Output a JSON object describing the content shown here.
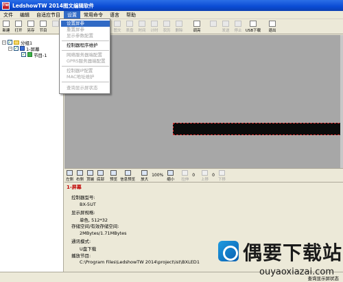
{
  "window": {
    "title": "LedshowTW 2014图文编辑软件",
    "icon_text": "TW"
  },
  "menu": [
    "文件",
    "编辑",
    "自适应节目",
    "设置",
    "常用命令",
    "语言",
    "帮助"
  ],
  "toolbar": {
    "buttons": [
      {
        "label": "新建",
        "disabled": false
      },
      {
        "label": "打开",
        "disabled": false
      },
      {
        "label": "另存",
        "disabled": false
      },
      {
        "label": "节目",
        "disabled": false
      },
      {
        "label": "",
        "disabled": true
      },
      {
        "label": "",
        "disabled": true
      },
      {
        "label": "文",
        "disabled": true
      },
      {
        "label": "字幕",
        "disabled": true
      },
      {
        "label": "动画",
        "disabled": true
      },
      {
        "label": "图文",
        "disabled": true
      },
      {
        "label": "表盘",
        "disabled": true
      },
      {
        "label": "时间",
        "disabled": true
      },
      {
        "label": "计时",
        "disabled": true
      },
      {
        "label": "农历",
        "disabled": true
      },
      {
        "label": "删除",
        "disabled": true
      },
      {
        "label": "调亮",
        "disabled": false
      },
      {
        "label": "",
        "disabled": true
      },
      {
        "label": "发送",
        "disabled": true
      },
      {
        "label": "停止",
        "disabled": true
      },
      {
        "label": "USB下载",
        "disabled": false
      },
      {
        "label": "退出",
        "disabled": false
      }
    ]
  },
  "dropdown": {
    "items": [
      {
        "label": "设置屏参",
        "state": "highlight"
      },
      {
        "label": "重置屏参",
        "state": "disabled"
      },
      {
        "label": "显示参数配置",
        "state": "disabled"
      },
      {
        "label": "控制器程序维护",
        "state": "normal"
      },
      {
        "label": "网络服务器端配置",
        "state": "disabled"
      },
      {
        "label": "GPRS服务器端配置",
        "state": "disabled"
      },
      {
        "label": "控制器IP配置",
        "state": "disabled"
      },
      {
        "label": "MAC地址维护",
        "state": "disabled"
      },
      {
        "label": "查询显示屏状态",
        "state": "disabled"
      }
    ]
  },
  "tree": {
    "group": "分组1",
    "screen": "1-屏幕",
    "program": "节目-1"
  },
  "props_toolbar": {
    "buttons": [
      "左侧",
      "右侧",
      "顶端",
      "底部",
      "预览",
      "信息预览",
      "放大"
    ],
    "zoom_value": "100%",
    "zoom_out_label": "缩小",
    "disabled_buttons": [
      "拉伸",
      "上移",
      "下移"
    ],
    "counter_values": [
      "0",
      "0"
    ]
  },
  "props": {
    "title": "1-屏幕",
    "lines": [
      "控制器型号:",
      "BX-5UT",
      "显示屏规格:",
      "单色, 512*32",
      "存储空间/有效存储空间:",
      "2MBytes/1.71MBytes",
      "通讯模式:",
      "U盘下载",
      "播放节目:",
      "C:\\Program Files\\LedshowTW 2014\\project\\ist\\BXLED1"
    ]
  },
  "status": {
    "text": "查询显示屏状态"
  },
  "watermark": {
    "brand": "偶要下载站",
    "url": "ouyaoxiazai.com"
  },
  "colors": {
    "titlebar": "#0a4bd4",
    "highlight": "#316ac5",
    "canvas": "#a7a7a7",
    "led": "#0a0a0a",
    "props_title": "#c00000"
  }
}
